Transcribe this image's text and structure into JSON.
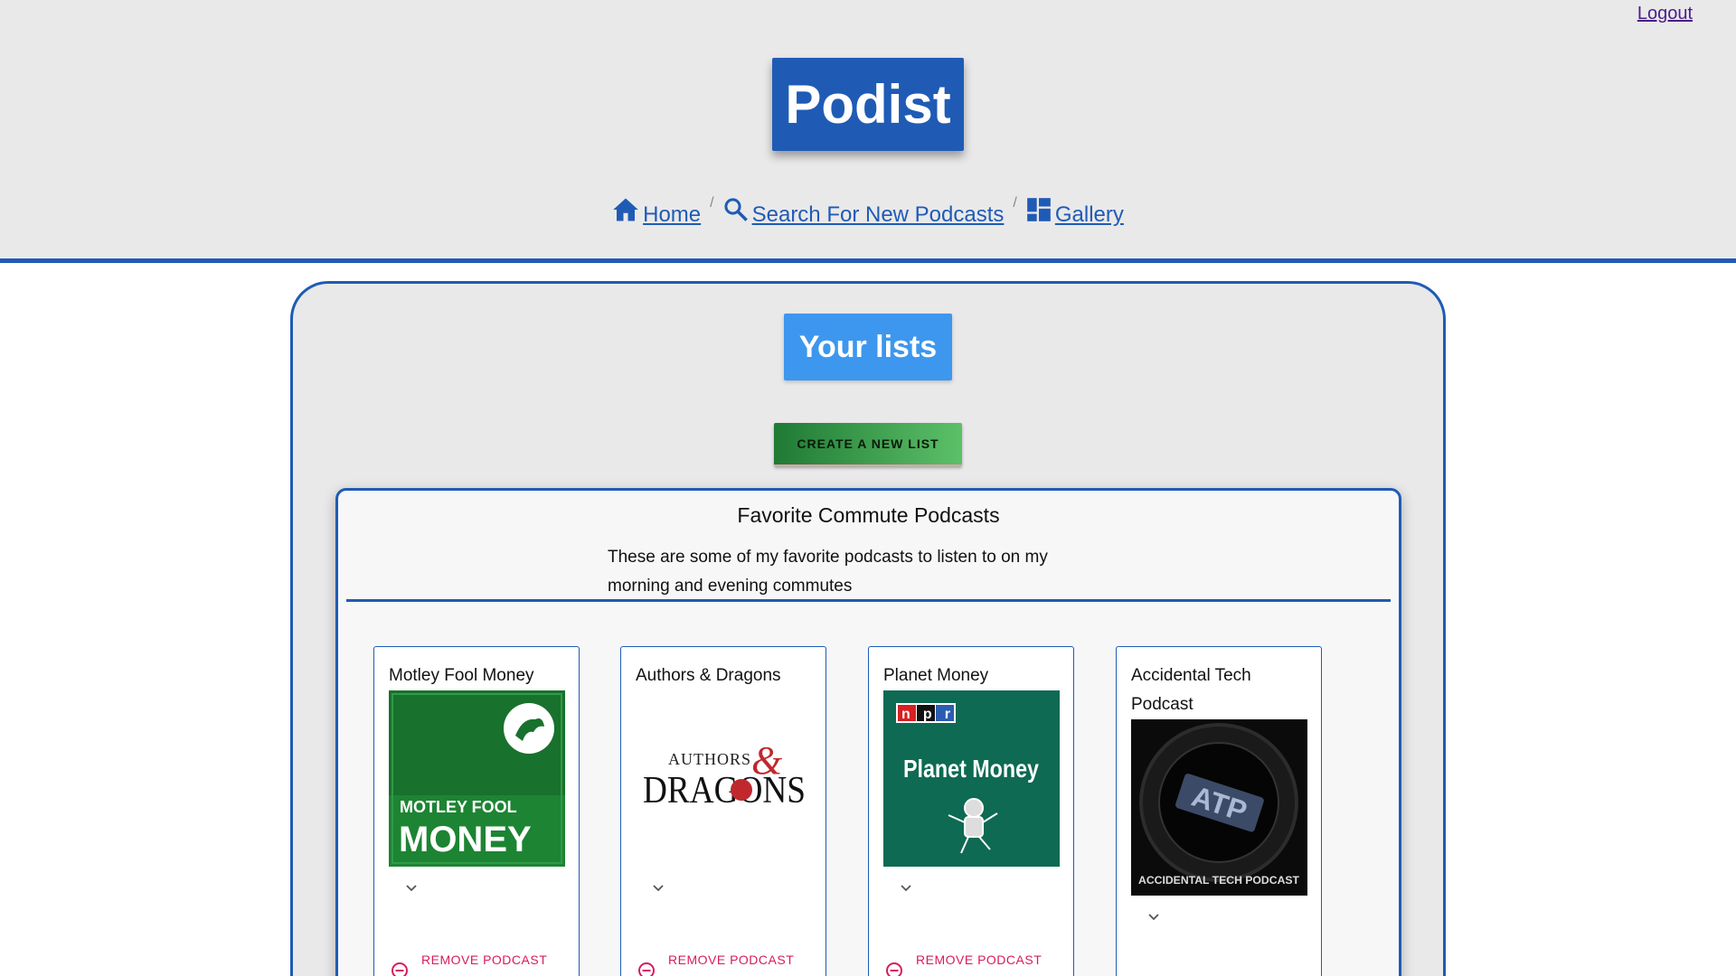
{
  "header": {
    "logout_label": "Logout",
    "brand": "Podist",
    "nav": [
      {
        "label": "Home",
        "icon": "home-icon"
      },
      {
        "label": "Search For New Podcasts",
        "icon": "search-icon"
      },
      {
        "label": "Gallery",
        "icon": "gallery-icon"
      }
    ],
    "separator": "/"
  },
  "main": {
    "heading": "Your lists",
    "create_button": "CREATE A NEW LIST",
    "list": {
      "title": "Favorite Commute Podcasts",
      "description": "These are some of my favorite podcasts to listen to on my morning and evening commutes",
      "podcasts": [
        {
          "name": "Motley Fool Money",
          "art_text_top": "MOTLEY FOOL",
          "art_text_bottom": "MONEY",
          "remove_label": "REMOVE PODCAST"
        },
        {
          "name": "Authors & Dragons",
          "art_text_top": "AUTHORS",
          "art_text_bottom": "DRAGONS",
          "remove_label": "REMOVE PODCAST"
        },
        {
          "name": "Planet Money",
          "art_badge": "npr",
          "art_text_top": "Planet Money",
          "remove_label": "REMOVE PODCAST"
        },
        {
          "name": "Accidental Tech Podcast",
          "art_text_top": "ATP",
          "art_text_bottom": "ACCIDENTAL TECH PODCAST"
        }
      ]
    }
  },
  "colors": {
    "brand_blue": "#1f5bb5",
    "heading_blue": "#3d97ee",
    "create_green": "#2e8b3e",
    "remove_pink": "#d81b60"
  }
}
